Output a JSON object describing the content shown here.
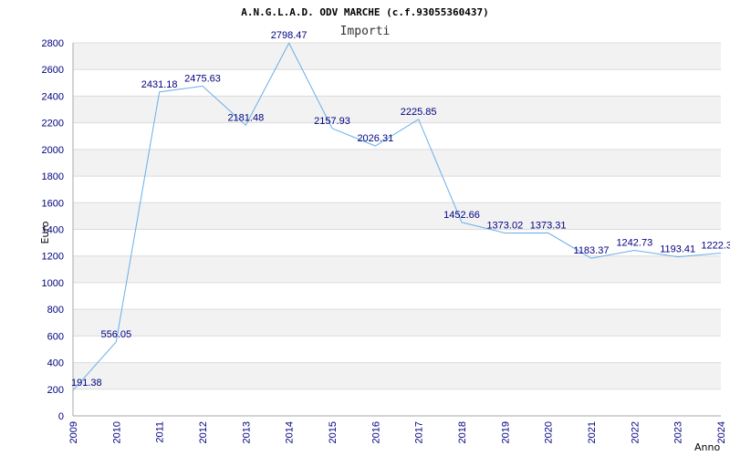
{
  "chart_data": {
    "type": "line",
    "title": "A.N.G.L.A.D. ODV MARCHE (c.f.93055360437)",
    "subtitle": "Importi",
    "xlabel": "Anno",
    "ylabel": "Euro",
    "ylim": [
      0,
      2800
    ],
    "yticks": [
      0,
      200,
      400,
      600,
      800,
      1000,
      1200,
      1400,
      1600,
      1800,
      2000,
      2200,
      2400,
      2600,
      2800
    ],
    "x": [
      2009,
      2010,
      2011,
      2012,
      2013,
      2014,
      2015,
      2016,
      2017,
      2018,
      2019,
      2020,
      2021,
      2022,
      2023,
      2024
    ],
    "values": [
      191.38,
      556.05,
      2431.18,
      2475.63,
      2181.48,
      2798.47,
      2157.93,
      2026.31,
      2225.85,
      1452.66,
      1373.02,
      1373.31,
      1183.37,
      1242.73,
      1193.41,
      1222.3
    ],
    "labels": [
      "191.38",
      "556.05",
      "2431.18",
      "2475.63",
      "2181.48",
      "2798.47",
      "2157.93",
      "2026.31",
      "2225.85",
      "1452.66",
      "1373.02",
      "1373.31",
      "1183.37",
      "1242.73",
      "1193.41",
      "1222.3"
    ],
    "grid": true,
    "colors": {
      "line": "#6aaee8",
      "band": "#f2f2f2",
      "grid": "#dcdcdc",
      "tick_text": "#000080"
    }
  }
}
